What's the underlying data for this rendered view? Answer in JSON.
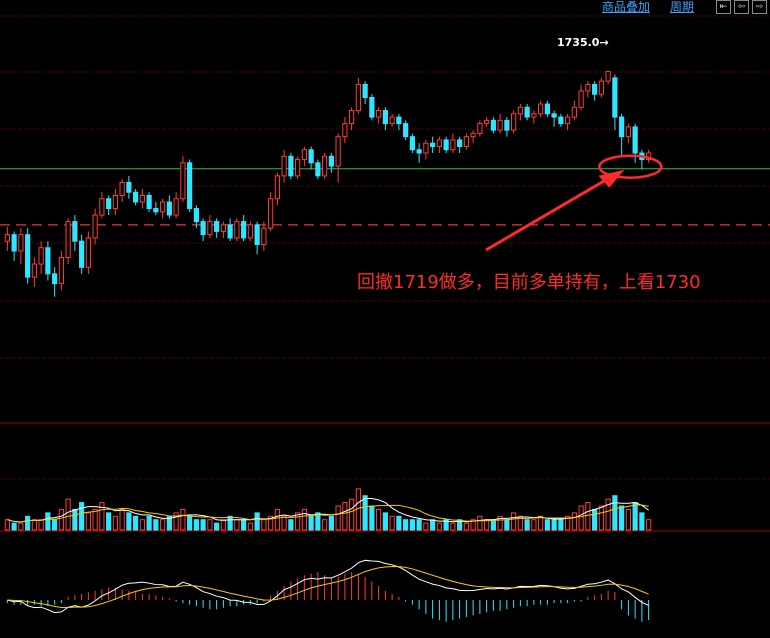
{
  "toolbar": {
    "overlay_label": "商品叠加",
    "period_label": "周期",
    "nav_buttons": [
      "⇤",
      "⇦",
      "⇨"
    ]
  },
  "annotation": {
    "text": "回撤1719做多，目前多单持有，上看1730",
    "high_label": "1735.0→"
  },
  "colors": {
    "background": "#000000",
    "up": "#ff3b3b",
    "down": "#2ee6ff",
    "grid": "#8b0000",
    "support_line": "#2fbf2f",
    "dash_line": "#e03a3a",
    "ma_yellow": "#f0d000",
    "ma_white": "#ffffff",
    "annotation": "#ff2a2a"
  },
  "chart_data": [
    {
      "type": "candlestick",
      "title": "",
      "ylim": [
        1690,
        1740
      ],
      "highest_label": 1735.0,
      "horizontal_lines": {
        "support": 1720.1,
        "dashed": 1711.5
      },
      "candles": [
        [
          1709.0,
          1710.0,
          1707.5,
          1711.2
        ],
        [
          1710.0,
          1707.5,
          1706.0,
          1710.5
        ],
        [
          1707.5,
          1710.0,
          1705.5,
          1711.0
        ],
        [
          1710.0,
          1703.5,
          1702.5,
          1711.0
        ],
        [
          1703.5,
          1705.5,
          1702.0,
          1706.5
        ],
        [
          1705.5,
          1708.0,
          1704.0,
          1709.0
        ],
        [
          1708.0,
          1704.0,
          1703.0,
          1709.0
        ],
        [
          1704.0,
          1702.5,
          1700.5,
          1705.0
        ],
        [
          1702.5,
          1706.5,
          1701.5,
          1707.5
        ],
        [
          1706.5,
          1712.0,
          1705.5,
          1712.5
        ],
        [
          1712.0,
          1709.0,
          1707.5,
          1713.0
        ],
        [
          1709.0,
          1705.0,
          1704.0,
          1710.0
        ],
        [
          1705.0,
          1709.5,
          1704.0,
          1710.5
        ],
        [
          1709.5,
          1713.0,
          1708.5,
          1714.0
        ],
        [
          1713.0,
          1715.5,
          1712.5,
          1716.5
        ],
        [
          1715.5,
          1714.0,
          1713.0,
          1716.0
        ],
        [
          1714.0,
          1716.0,
          1713.0,
          1717.0
        ],
        [
          1716.0,
          1718.0,
          1715.0,
          1718.5
        ],
        [
          1718.0,
          1716.5,
          1715.5,
          1719.0
        ],
        [
          1716.5,
          1715.0,
          1714.5,
          1717.0
        ],
        [
          1715.0,
          1716.0,
          1714.0,
          1717.0
        ],
        [
          1716.0,
          1714.0,
          1713.5,
          1716.5
        ],
        [
          1714.0,
          1713.5,
          1713.0,
          1715.0
        ],
        [
          1713.5,
          1715.0,
          1712.5,
          1715.5
        ],
        [
          1715.0,
          1713.0,
          1712.5,
          1716.0
        ],
        [
          1713.0,
          1715.5,
          1712.5,
          1716.5
        ],
        [
          1715.5,
          1721.0,
          1715.0,
          1722.0
        ],
        [
          1721.0,
          1714.0,
          1713.5,
          1721.5
        ],
        [
          1714.0,
          1712.0,
          1711.0,
          1714.5
        ],
        [
          1712.0,
          1710.0,
          1709.0,
          1712.5
        ],
        [
          1710.0,
          1712.0,
          1709.5,
          1713.0
        ],
        [
          1712.0,
          1710.5,
          1709.5,
          1712.5
        ],
        [
          1710.5,
          1711.5,
          1709.5,
          1712.0
        ],
        [
          1711.5,
          1709.5,
          1709.0,
          1712.5
        ],
        [
          1709.5,
          1712.0,
          1709.0,
          1712.5
        ],
        [
          1712.0,
          1709.5,
          1709.0,
          1713.0
        ],
        [
          1709.5,
          1711.5,
          1709.0,
          1712.0
        ],
        [
          1711.5,
          1708.5,
          1707.0,
          1712.0
        ],
        [
          1708.5,
          1711.0,
          1707.5,
          1712.0
        ],
        [
          1711.0,
          1715.5,
          1710.5,
          1716.5
        ],
        [
          1715.5,
          1719.0,
          1714.5,
          1719.5
        ],
        [
          1719.0,
          1722.0,
          1718.0,
          1723.0
        ],
        [
          1722.0,
          1719.0,
          1718.5,
          1722.5
        ],
        [
          1719.0,
          1721.5,
          1718.5,
          1722.0
        ],
        [
          1721.5,
          1723.0,
          1720.5,
          1723.5
        ],
        [
          1723.0,
          1721.0,
          1720.0,
          1723.5
        ],
        [
          1721.0,
          1719.0,
          1718.5,
          1721.5
        ],
        [
          1719.0,
          1722.0,
          1718.5,
          1722.5
        ],
        [
          1722.0,
          1720.5,
          1719.5,
          1722.5
        ],
        [
          1720.5,
          1725.0,
          1718.0,
          1725.5
        ],
        [
          1725.0,
          1727.0,
          1724.0,
          1728.0
        ],
        [
          1727.0,
          1729.0,
          1726.0,
          1729.5
        ],
        [
          1729.0,
          1733.0,
          1728.5,
          1734.0
        ],
        [
          1733.0,
          1731.0,
          1730.0,
          1733.5
        ],
        [
          1731.0,
          1728.0,
          1727.5,
          1731.5
        ],
        [
          1728.0,
          1729.0,
          1727.0,
          1729.5
        ],
        [
          1729.0,
          1727.0,
          1726.0,
          1729.5
        ],
        [
          1727.0,
          1728.0,
          1726.5,
          1728.5
        ],
        [
          1728.0,
          1727.0,
          1726.0,
          1728.5
        ],
        [
          1727.0,
          1725.0,
          1724.5,
          1727.5
        ],
        [
          1725.0,
          1723.0,
          1722.5,
          1725.5
        ],
        [
          1723.0,
          1722.5,
          1721.0,
          1724.0
        ],
        [
          1722.5,
          1724.0,
          1721.5,
          1724.5
        ],
        [
          1724.0,
          1723.5,
          1722.5,
          1725.0
        ],
        [
          1723.5,
          1724.5,
          1722.5,
          1725.0
        ],
        [
          1724.5,
          1723.0,
          1722.5,
          1725.0
        ],
        [
          1723.0,
          1724.5,
          1722.5,
          1725.5
        ],
        [
          1724.5,
          1723.5,
          1722.5,
          1725.0
        ],
        [
          1723.5,
          1725.0,
          1723.0,
          1725.5
        ],
        [
          1725.0,
          1725.5,
          1724.0,
          1726.0
        ],
        [
          1725.5,
          1727.0,
          1725.0,
          1727.5
        ],
        [
          1727.0,
          1727.5,
          1726.5,
          1728.0
        ],
        [
          1727.5,
          1726.0,
          1725.5,
          1728.0
        ],
        [
          1726.0,
          1727.5,
          1725.5,
          1728.5
        ],
        [
          1727.5,
          1726.0,
          1725.0,
          1728.0
        ],
        [
          1726.0,
          1728.5,
          1725.5,
          1729.0
        ],
        [
          1728.5,
          1729.5,
          1727.5,
          1730.0
        ],
        [
          1729.5,
          1728.0,
          1727.5,
          1730.0
        ],
        [
          1728.0,
          1728.5,
          1727.0,
          1729.0
        ],
        [
          1728.5,
          1730.0,
          1728.0,
          1730.5
        ],
        [
          1730.0,
          1728.5,
          1728.0,
          1730.5
        ],
        [
          1728.5,
          1728.0,
          1726.5,
          1729.0
        ],
        [
          1728.0,
          1727.0,
          1726.5,
          1728.5
        ],
        [
          1727.0,
          1728.0,
          1726.0,
          1728.5
        ],
        [
          1728.0,
          1729.5,
          1727.5,
          1730.5
        ],
        [
          1729.5,
          1732.0,
          1729.0,
          1733.0
        ],
        [
          1732.0,
          1733.0,
          1731.0,
          1733.5
        ],
        [
          1733.0,
          1731.5,
          1730.5,
          1733.5
        ],
        [
          1731.5,
          1733.5,
          1731.0,
          1734.0
        ],
        [
          1733.5,
          1735.0,
          1733.0,
          1735.0
        ],
        [
          1734.0,
          1728.0,
          1726.0,
          1734.5
        ],
        [
          1728.0,
          1725.0,
          1722.0,
          1728.5
        ],
        [
          1725.0,
          1726.5,
          1724.0,
          1727.0
        ],
        [
          1726.5,
          1722.5,
          1721.0,
          1727.0
        ],
        [
          1722.5,
          1721.5,
          1720.0,
          1723.0
        ],
        [
          1721.5,
          1722.5,
          1721.0,
          1723.0
        ]
      ],
      "volume": [
        3,
        2,
        2,
        4,
        3,
        3,
        5,
        3,
        6,
        9,
        6,
        8,
        5,
        6,
        8,
        5,
        4,
        6,
        5,
        4,
        3,
        4,
        3,
        3,
        4,
        5,
        6,
        4,
        3,
        3,
        3,
        2,
        3,
        4,
        3,
        3,
        2,
        5,
        3,
        4,
        6,
        4,
        3,
        5,
        6,
        4,
        5,
        3,
        4,
        7,
        8,
        9,
        12,
        10,
        7,
        6,
        5,
        4,
        4,
        3,
        3,
        3,
        2,
        3,
        2,
        3,
        2,
        3,
        2,
        3,
        4,
        3,
        3,
        4,
        3,
        5,
        4,
        3,
        3,
        4,
        3,
        3,
        3,
        4,
        5,
        7,
        8,
        6,
        7,
        9,
        10,
        7,
        6,
        8,
        5,
        3
      ],
      "macd_hist": [
        -2,
        -3,
        -3,
        -4,
        -3,
        -4,
        -4,
        -3,
        -2,
        2,
        3,
        4,
        5,
        6,
        7,
        8,
        8,
        7,
        6,
        5,
        4,
        4,
        3,
        2,
        1,
        -1,
        -2,
        -3,
        -4,
        -5,
        -6,
        -6,
        -5,
        -4,
        -4,
        -3,
        -3,
        -2,
        -1,
        3,
        6,
        9,
        12,
        14,
        16,
        17,
        18,
        16,
        14,
        15,
        17,
        18,
        17,
        15,
        12,
        9,
        6,
        4,
        2,
        -1,
        -3,
        -6,
        -9,
        -12,
        -13,
        -14,
        -13,
        -12,
        -11,
        -10,
        -9,
        -8,
        -7,
        -7,
        -6,
        -5,
        -4,
        -4,
        -3,
        -3,
        -3,
        -2,
        -2,
        -2,
        -1,
        -1,
        2,
        3,
        4,
        6,
        5,
        -6,
        -10,
        -12,
        -14,
        -13
      ]
    }
  ]
}
